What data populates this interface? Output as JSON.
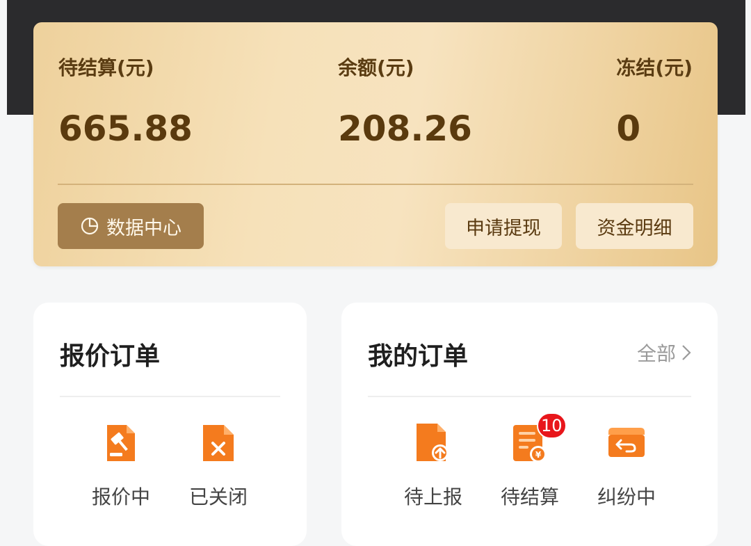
{
  "wallet": {
    "pending_label": "待结算(元)",
    "pending_value": "665.88",
    "balance_label": "余额(元)",
    "balance_value": "208.26",
    "frozen_label": "冻结(元)",
    "frozen_value": "0",
    "data_center_label": "数据中心",
    "withdraw_label": "申请提现",
    "fund_detail_label": "资金明细"
  },
  "quote_orders": {
    "title": "报价订单",
    "items": [
      {
        "label": "报价中",
        "icon": "auction-hammer-icon"
      },
      {
        "label": "已关闭",
        "icon": "document-close-icon"
      }
    ]
  },
  "my_orders": {
    "title": "我的订单",
    "see_all_label": "全部",
    "items": [
      {
        "label": "待上报",
        "icon": "document-upload-icon"
      },
      {
        "label": "待结算",
        "icon": "bill-yuan-icon",
        "badge": "10"
      },
      {
        "label": "纠纷中",
        "icon": "return-box-icon"
      }
    ]
  },
  "colors": {
    "accent_orange": "#f47b1e",
    "badge_red": "#e8161b",
    "wallet_text": "#5a3a0e"
  }
}
